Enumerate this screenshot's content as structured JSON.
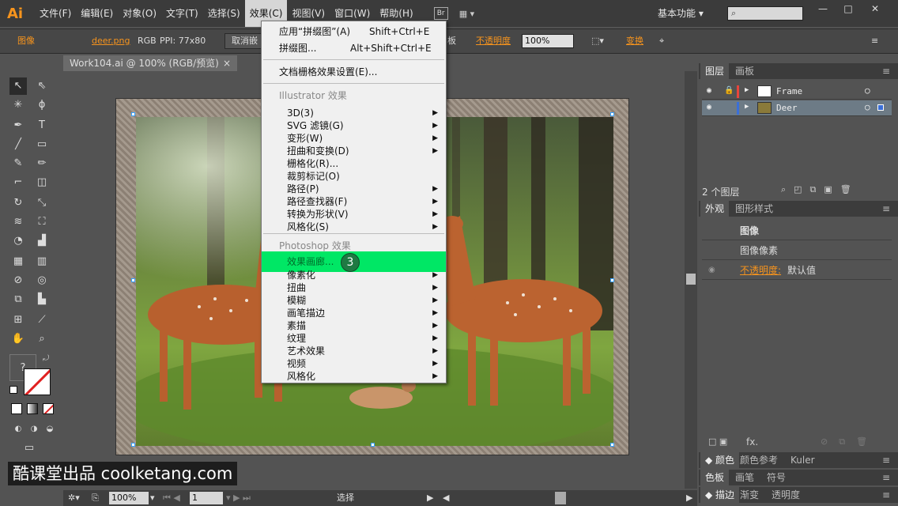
{
  "app": {
    "logo": "Ai",
    "menus": [
      "文件(F)",
      "编辑(E)",
      "对象(O)",
      "文字(T)",
      "选择(S)",
      "效果(C)",
      "视图(V)",
      "窗口(W)",
      "帮助(H)"
    ],
    "active_menu": "效果(C)",
    "bridge_label": "Br",
    "workspace": "基本功能 ▾",
    "window_controls": [
      "—",
      "□",
      "✕"
    ]
  },
  "control_bar": {
    "object_type": "图像",
    "file_name": "deer.png",
    "color_mode": "RGB",
    "ppi": "PPI: 77x80",
    "cancel_embed": "取消嵌",
    "dropdown_fragment": "板",
    "opacity_label": "不透明度",
    "opacity_value": "100%",
    "transform_label": "变换"
  },
  "document": {
    "tab_title": "Work104.ai @ 100% (RGB/预览)",
    "tab_close": "×"
  },
  "effect_menu": {
    "apply_last": {
      "label": "应用“拼缀图”(A)",
      "shortcut": "Shift+Ctrl+E"
    },
    "last_effect": {
      "label": "拼缀图...",
      "shortcut": "Alt+Shift+Ctrl+E"
    },
    "raster_settings": "文档栅格效果设置(E)...",
    "illustrator_header": "Illustrator 效果",
    "illustrator_items": [
      "3D(3)",
      "SVG 滤镜(G)",
      "变形(W)",
      "扭曲和变换(D)",
      "栅格化(R)...",
      "裁剪标记(O)",
      "路径(P)",
      "路径查找器(F)",
      "转换为形状(V)",
      "风格化(S)"
    ],
    "illustrator_submenus": [
      true,
      true,
      true,
      true,
      false,
      false,
      true,
      true,
      true,
      true
    ],
    "photoshop_header": "Photoshop 效果",
    "gallery": "效果画廊...",
    "photoshop_items": [
      "像素化",
      "扭曲",
      "模糊",
      "画笔描边",
      "素描",
      "纹理",
      "艺术效果",
      "视频",
      "风格化"
    ],
    "step_badge": "3"
  },
  "layers_panel": {
    "tabs": [
      "图层",
      "画板"
    ],
    "layers": [
      {
        "name": "Frame",
        "color": "#e8453c"
      },
      {
        "name": "Deer",
        "color": "#3a6fd8"
      }
    ],
    "count": "2 个图层"
  },
  "appearance_panel": {
    "tabs": [
      "外观",
      "图形样式"
    ],
    "title": "图像",
    "pixels": "图像像素",
    "opacity_label": "不透明度:",
    "opacity_value": "默认值",
    "fx_label": "fx."
  },
  "bottom_panels": {
    "row1": [
      "颜色",
      "颜色参考",
      "Kuler"
    ],
    "row2": [
      "色板",
      "画笔",
      "符号"
    ],
    "row3": [
      "描边",
      "渐变",
      "透明度"
    ]
  },
  "status_bar": {
    "zoom": "100%",
    "page": "1",
    "tool": "选择"
  },
  "toolbar": {
    "fill_stroke_help": "?"
  },
  "watermark": "酷课堂出品 coolketang.com",
  "colors": {
    "highlight": "#00e765",
    "accent": "#f7941d",
    "badge": "#1f7a43"
  }
}
